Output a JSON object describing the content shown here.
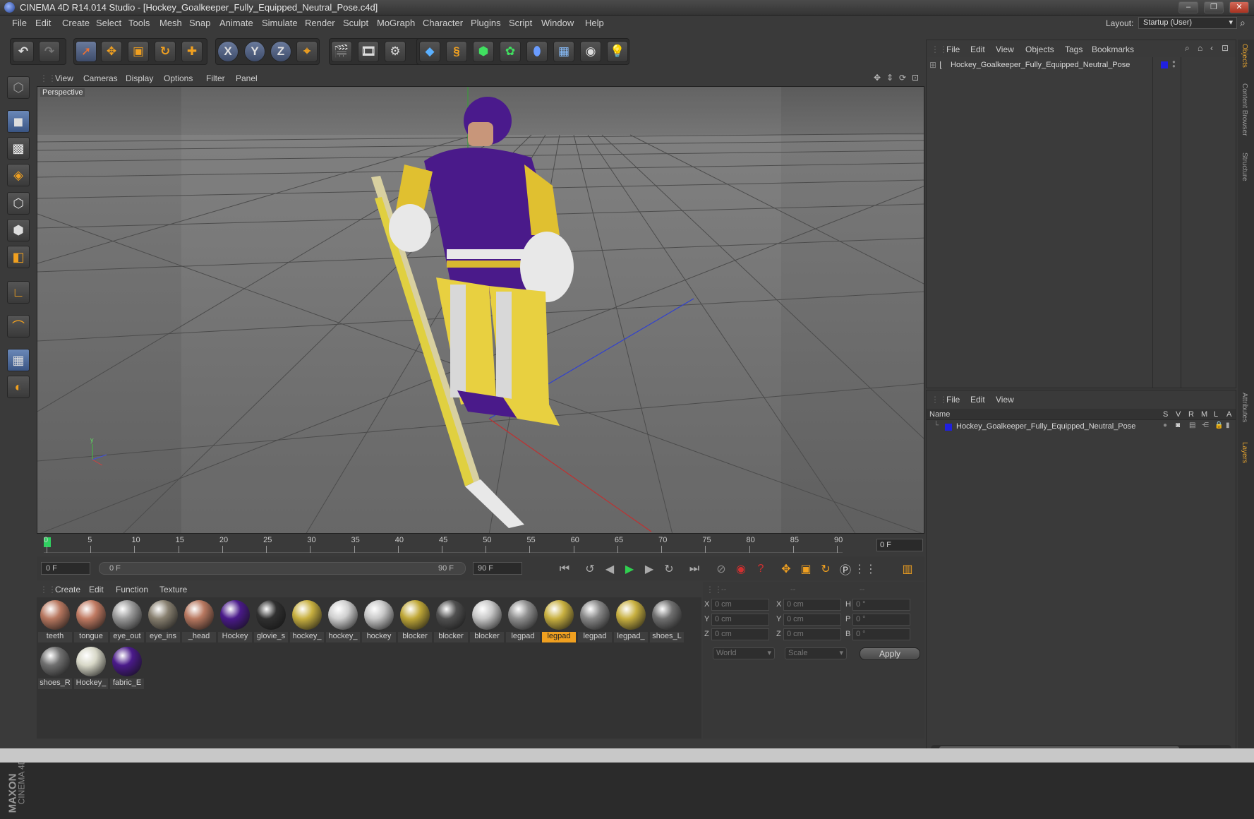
{
  "window": {
    "title": "CINEMA 4D R14.014 Studio - [Hockey_Goalkeeper_Fully_Equipped_Neutral_Pose.c4d]",
    "controls": [
      "–",
      "❐",
      "✕"
    ]
  },
  "menubar": {
    "items": [
      "File",
      "Edit",
      "Create",
      "Select",
      "Tools",
      "Mesh",
      "Snap",
      "Animate",
      "Simulate",
      "Render",
      "Sculpt",
      "MoGraph",
      "Character",
      "Plugins",
      "Script",
      "Window",
      "Help"
    ],
    "layout_label": "Layout:",
    "layout_value": "Startup (User)"
  },
  "toolbar": {
    "axis_x": "X",
    "axis_y": "Y",
    "axis_z": "Z"
  },
  "viewport": {
    "menu": [
      "View",
      "Cameras",
      "Display",
      "Options",
      "Filter",
      "Panel"
    ],
    "label": "Perspective",
    "axis_y": "y"
  },
  "timeline": {
    "ticks": [
      "0",
      "5",
      "10",
      "15",
      "20",
      "25",
      "30",
      "35",
      "40",
      "45",
      "50",
      "55",
      "60",
      "65",
      "70",
      "75",
      "80",
      "85",
      "90"
    ],
    "current_frame": "0 F",
    "start_frame": "0 F",
    "range_start": "0 F",
    "range_end": "90 F",
    "end_frame": "90 F"
  },
  "materials": {
    "menu": [
      "Create",
      "Edit",
      "Function",
      "Texture"
    ],
    "items": [
      {
        "name": "teeth",
        "color": "#b87860"
      },
      {
        "name": "tongue",
        "color": "#c07a62"
      },
      {
        "name": "eye_out",
        "color": "#9a9a9a"
      },
      {
        "name": "eye_ins",
        "color": "#888070"
      },
      {
        "name": "_head",
        "color": "#b87860"
      },
      {
        "name": "Hockey",
        "color": "#4a1a8a"
      },
      {
        "name": "glovie_s",
        "color": "#303030"
      },
      {
        "name": "hockey_",
        "color": "#c8b040"
      },
      {
        "name": "hockey_",
        "color": "#d0d0d0"
      },
      {
        "name": "hockey",
        "color": "#c8c8c8"
      },
      {
        "name": "blocker",
        "color": "#c0a838"
      },
      {
        "name": "blocker",
        "color": "#505050"
      },
      {
        "name": "blocker",
        "color": "#c8c8c8"
      },
      {
        "name": "legpad",
        "color": "#909090"
      },
      {
        "name": "legpad",
        "color": "#c8b040",
        "selected": true
      },
      {
        "name": "legpad",
        "color": "#888"
      },
      {
        "name": "legpad_",
        "color": "#c8b040"
      },
      {
        "name": "shoes_L",
        "color": "#707070"
      },
      {
        "name": "shoes_R",
        "color": "#707070"
      },
      {
        "name": "Hockey_",
        "color": "#d8d8c8"
      },
      {
        "name": "fabric_E",
        "color": "#4a1a8a"
      }
    ]
  },
  "coordinates": {
    "header": [
      "--",
      "--",
      "--"
    ],
    "rows": [
      {
        "a": "X",
        "av": "0 cm",
        "b": "X",
        "bv": "0 cm",
        "c": "H",
        "cv": "0 °"
      },
      {
        "a": "Y",
        "av": "0 cm",
        "b": "Y",
        "bv": "0 cm",
        "c": "P",
        "cv": "0 °"
      },
      {
        "a": "Z",
        "av": "0 cm",
        "b": "Z",
        "bv": "0 cm",
        "c": "B",
        "cv": "0 °"
      }
    ],
    "mode1": "World",
    "mode2": "Scale",
    "apply": "Apply"
  },
  "objects": {
    "menu": [
      "File",
      "Edit",
      "View",
      "Objects",
      "Tags",
      "Bookmarks"
    ],
    "item": "Hockey_Goalkeeper_Fully_Equipped_Neutral_Pose"
  },
  "layers": {
    "menu": [
      "File",
      "Edit",
      "View"
    ],
    "col_name": "Name",
    "cols": [
      "S",
      "V",
      "R",
      "M",
      "L",
      "A"
    ],
    "item": "Hockey_Goalkeeper_Fully_Equipped_Neutral_Pose"
  },
  "side_tabs": [
    "Objects",
    "Content Browser",
    "Structure",
    "Attributes",
    "Layers"
  ],
  "brand": {
    "line1": "MAXON",
    "line2": "CINEMA 4D"
  }
}
